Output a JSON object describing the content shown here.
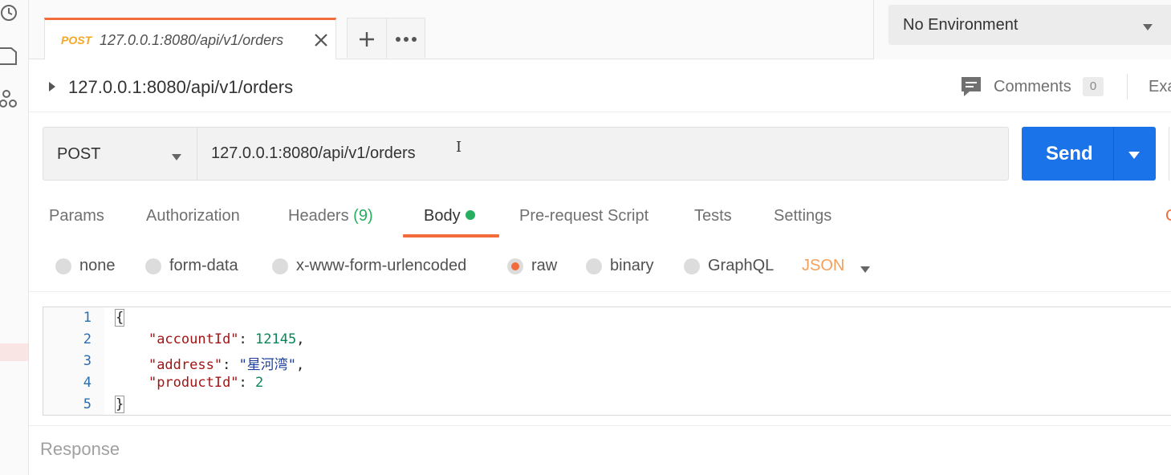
{
  "tab": {
    "method": "POST",
    "title": "127.0.0.1:8080/api/v1/orders"
  },
  "environment": {
    "selected": "No Environment"
  },
  "request": {
    "name": "127.0.0.1:8080/api/v1/orders",
    "method": "POST",
    "url": "127.0.0.1:8080/api/v1/orders",
    "send_label": "Send"
  },
  "header_actions": {
    "comments_label": "Comments",
    "comments_count": "0",
    "examples_label": "Exa"
  },
  "request_tabs": {
    "params": "Params",
    "authorization": "Authorization",
    "headers": "Headers",
    "headers_count": "(9)",
    "body": "Body",
    "pre_request": "Pre-request Script",
    "tests": "Tests",
    "settings": "Settings",
    "cookies_partial": "C"
  },
  "body_types": {
    "none": "none",
    "form_data": "form-data",
    "urlencoded": "x-www-form-urlencoded",
    "raw": "raw",
    "binary": "binary",
    "graphql": "GraphQL",
    "format": "JSON",
    "selected": "raw"
  },
  "editor": {
    "line_numbers": [
      "1",
      "2",
      "3",
      "4",
      "5"
    ],
    "open_brace": "{",
    "close_brace": "}",
    "fields": [
      {
        "key": "\"accountId\"",
        "sep": ": ",
        "value": "12145",
        "value_type": "number",
        "trail": ","
      },
      {
        "key": "\"address\"",
        "sep": ": ",
        "value": "\"星河湾\"",
        "value_type": "string",
        "trail": ","
      },
      {
        "key": "\"productId\"",
        "sep": ": ",
        "value": "2",
        "value_type": "number",
        "trail": ""
      }
    ]
  },
  "response": {
    "label": "Response"
  },
  "colors": {
    "accent": "#f26b3a",
    "send_blue": "#1a73e8",
    "post_orange": "#f5a623",
    "status_green": "#27ae60"
  }
}
